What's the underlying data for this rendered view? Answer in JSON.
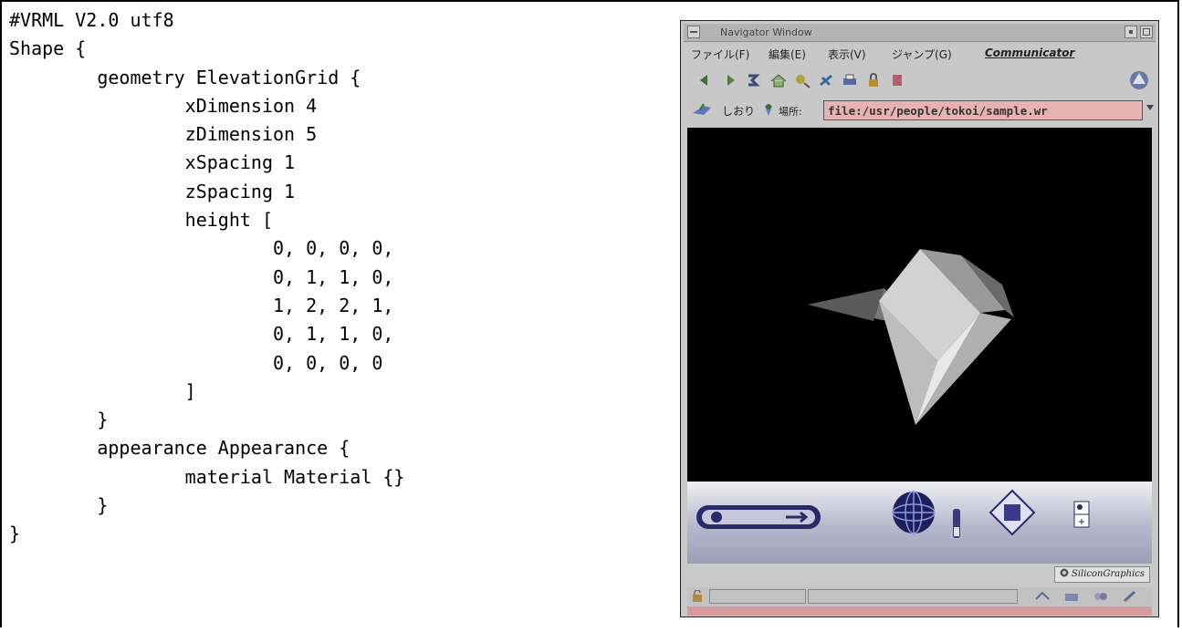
{
  "code_lines": [
    "#VRML V2.0 utf8",
    "Shape {",
    "        geometry ElevationGrid {",
    "                xDimension 4",
    "                zDimension 5",
    "                xSpacing 1",
    "                zSpacing 1",
    "                height [",
    "                        0, 0, 0, 0,",
    "                        0, 1, 1, 0,",
    "                        1, 2, 2, 1,",
    "                        0, 1, 1, 0,",
    "                        0, 0, 0, 0",
    "                ]",
    "        }",
    "        appearance Appearance {",
    "                material Material {}",
    "        }",
    "}"
  ],
  "navigator": {
    "title": "Navigator Window",
    "menu": [
      "ファイル(F)",
      "編集(E)",
      "表示(V)",
      "ジャンプ(G)",
      "Communicator"
    ],
    "bookmarks_label": "しおり",
    "location_label": "場所:",
    "location_value": "file:/usr/people/tokoi/sample.wr",
    "brand": "SiliconGraphics"
  },
  "colors": {
    "viewport_bg": "#000000",
    "location_field": "#e6b2b2",
    "status_bar_accent": "#d79a9a",
    "terrain_light": "#c8c8c8",
    "terrain_dark": "#707070"
  }
}
